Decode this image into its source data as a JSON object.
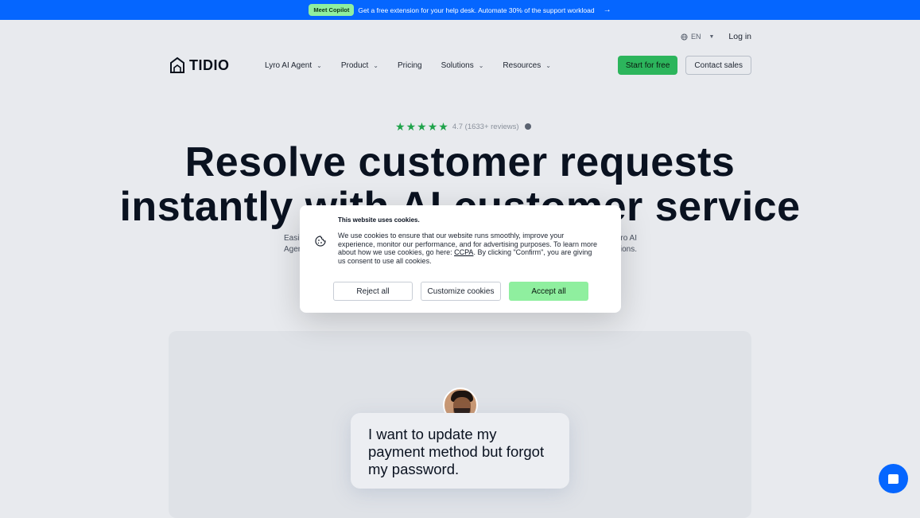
{
  "announcement": {
    "badge": "Meet Copilot",
    "text": "Get a free extension for your help desk. Automate 30% of the support workload",
    "arrow": "→"
  },
  "utility": {
    "language": "EN",
    "login": "Log in"
  },
  "nav": {
    "logo": "TIDIO",
    "items": [
      {
        "label": "Lyro AI Agent",
        "has_dropdown": true
      },
      {
        "label": "Product",
        "has_dropdown": true
      },
      {
        "label": "Pricing",
        "has_dropdown": false
      },
      {
        "label": "Solutions",
        "has_dropdown": true
      },
      {
        "label": "Resources",
        "has_dropdown": true
      }
    ],
    "cta_primary": "Start for free",
    "cta_secondary": "Contact sales"
  },
  "hero": {
    "rating_stars": 5,
    "rating_text": "4.7 (1633+ reviews)",
    "headline_line1": "Resolve customer requests",
    "headline_line2": "instantly with AI customer service",
    "sub_left1": "Easil",
    "sub_left2": "Agen",
    "sub_right1": "ro AI",
    "sub_right2": "ions."
  },
  "chat_preview": {
    "message": "I want to update my payment method but forgot my password."
  },
  "cookie_modal": {
    "title": "This website uses cookies.",
    "body_before_link": "We use cookies to ensure that our website runs smoothly, improve your experience, monitor our performance, and for advertising purposes. To learn more about how we use cookies, go here: ",
    "link": "CCPA",
    "body_after_link": ". By clicking \"Confirm\", you are giving us consent to use all cookies.",
    "reject": "Reject all",
    "customize": "Customize cookies",
    "accept": "Accept all"
  },
  "colors": {
    "brand_blue": "#0566ff",
    "green": "#2cb55c",
    "accept_green": "#8fef9f"
  }
}
